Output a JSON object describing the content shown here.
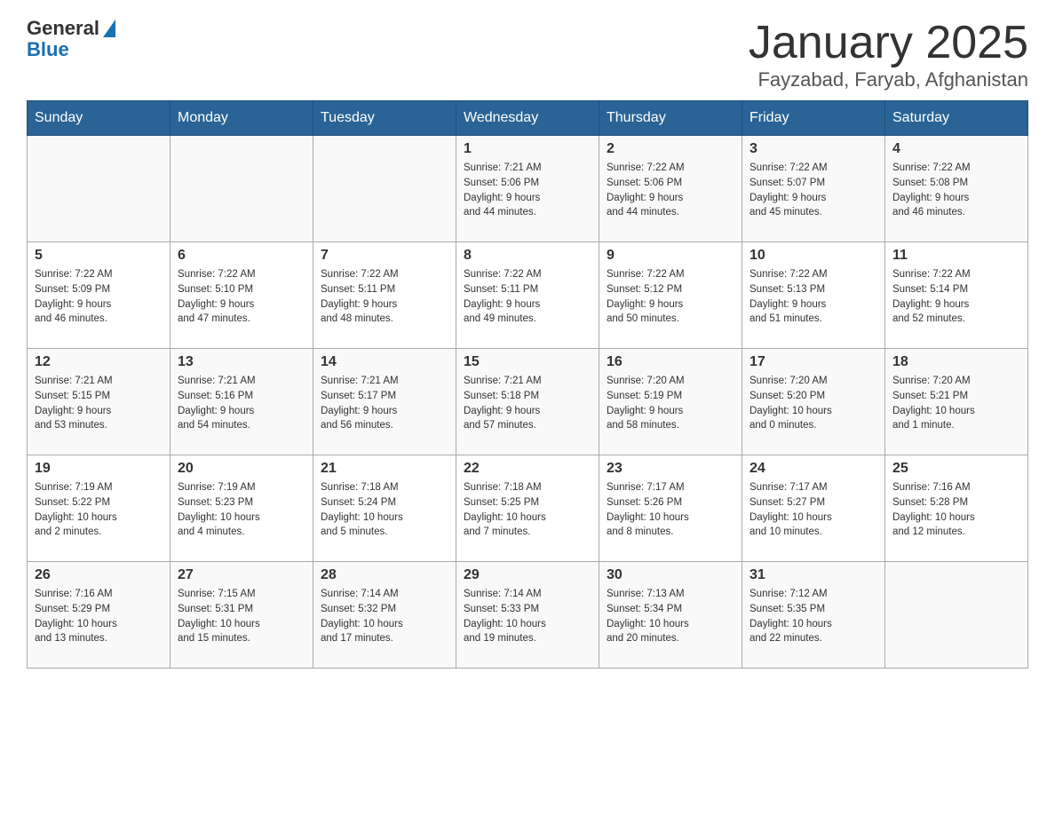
{
  "header": {
    "logo_line1": "General",
    "logo_line2": "Blue",
    "title": "January 2025",
    "subtitle": "Fayzabad, Faryab, Afghanistan"
  },
  "weekdays": [
    "Sunday",
    "Monday",
    "Tuesday",
    "Wednesday",
    "Thursday",
    "Friday",
    "Saturday"
  ],
  "weeks": [
    [
      {
        "day": "",
        "info": ""
      },
      {
        "day": "",
        "info": ""
      },
      {
        "day": "",
        "info": ""
      },
      {
        "day": "1",
        "info": "Sunrise: 7:21 AM\nSunset: 5:06 PM\nDaylight: 9 hours\nand 44 minutes."
      },
      {
        "day": "2",
        "info": "Sunrise: 7:22 AM\nSunset: 5:06 PM\nDaylight: 9 hours\nand 44 minutes."
      },
      {
        "day": "3",
        "info": "Sunrise: 7:22 AM\nSunset: 5:07 PM\nDaylight: 9 hours\nand 45 minutes."
      },
      {
        "day": "4",
        "info": "Sunrise: 7:22 AM\nSunset: 5:08 PM\nDaylight: 9 hours\nand 46 minutes."
      }
    ],
    [
      {
        "day": "5",
        "info": "Sunrise: 7:22 AM\nSunset: 5:09 PM\nDaylight: 9 hours\nand 46 minutes."
      },
      {
        "day": "6",
        "info": "Sunrise: 7:22 AM\nSunset: 5:10 PM\nDaylight: 9 hours\nand 47 minutes."
      },
      {
        "day": "7",
        "info": "Sunrise: 7:22 AM\nSunset: 5:11 PM\nDaylight: 9 hours\nand 48 minutes."
      },
      {
        "day": "8",
        "info": "Sunrise: 7:22 AM\nSunset: 5:11 PM\nDaylight: 9 hours\nand 49 minutes."
      },
      {
        "day": "9",
        "info": "Sunrise: 7:22 AM\nSunset: 5:12 PM\nDaylight: 9 hours\nand 50 minutes."
      },
      {
        "day": "10",
        "info": "Sunrise: 7:22 AM\nSunset: 5:13 PM\nDaylight: 9 hours\nand 51 minutes."
      },
      {
        "day": "11",
        "info": "Sunrise: 7:22 AM\nSunset: 5:14 PM\nDaylight: 9 hours\nand 52 minutes."
      }
    ],
    [
      {
        "day": "12",
        "info": "Sunrise: 7:21 AM\nSunset: 5:15 PM\nDaylight: 9 hours\nand 53 minutes."
      },
      {
        "day": "13",
        "info": "Sunrise: 7:21 AM\nSunset: 5:16 PM\nDaylight: 9 hours\nand 54 minutes."
      },
      {
        "day": "14",
        "info": "Sunrise: 7:21 AM\nSunset: 5:17 PM\nDaylight: 9 hours\nand 56 minutes."
      },
      {
        "day": "15",
        "info": "Sunrise: 7:21 AM\nSunset: 5:18 PM\nDaylight: 9 hours\nand 57 minutes."
      },
      {
        "day": "16",
        "info": "Sunrise: 7:20 AM\nSunset: 5:19 PM\nDaylight: 9 hours\nand 58 minutes."
      },
      {
        "day": "17",
        "info": "Sunrise: 7:20 AM\nSunset: 5:20 PM\nDaylight: 10 hours\nand 0 minutes."
      },
      {
        "day": "18",
        "info": "Sunrise: 7:20 AM\nSunset: 5:21 PM\nDaylight: 10 hours\nand 1 minute."
      }
    ],
    [
      {
        "day": "19",
        "info": "Sunrise: 7:19 AM\nSunset: 5:22 PM\nDaylight: 10 hours\nand 2 minutes."
      },
      {
        "day": "20",
        "info": "Sunrise: 7:19 AM\nSunset: 5:23 PM\nDaylight: 10 hours\nand 4 minutes."
      },
      {
        "day": "21",
        "info": "Sunrise: 7:18 AM\nSunset: 5:24 PM\nDaylight: 10 hours\nand 5 minutes."
      },
      {
        "day": "22",
        "info": "Sunrise: 7:18 AM\nSunset: 5:25 PM\nDaylight: 10 hours\nand 7 minutes."
      },
      {
        "day": "23",
        "info": "Sunrise: 7:17 AM\nSunset: 5:26 PM\nDaylight: 10 hours\nand 8 minutes."
      },
      {
        "day": "24",
        "info": "Sunrise: 7:17 AM\nSunset: 5:27 PM\nDaylight: 10 hours\nand 10 minutes."
      },
      {
        "day": "25",
        "info": "Sunrise: 7:16 AM\nSunset: 5:28 PM\nDaylight: 10 hours\nand 12 minutes."
      }
    ],
    [
      {
        "day": "26",
        "info": "Sunrise: 7:16 AM\nSunset: 5:29 PM\nDaylight: 10 hours\nand 13 minutes."
      },
      {
        "day": "27",
        "info": "Sunrise: 7:15 AM\nSunset: 5:31 PM\nDaylight: 10 hours\nand 15 minutes."
      },
      {
        "day": "28",
        "info": "Sunrise: 7:14 AM\nSunset: 5:32 PM\nDaylight: 10 hours\nand 17 minutes."
      },
      {
        "day": "29",
        "info": "Sunrise: 7:14 AM\nSunset: 5:33 PM\nDaylight: 10 hours\nand 19 minutes."
      },
      {
        "day": "30",
        "info": "Sunrise: 7:13 AM\nSunset: 5:34 PM\nDaylight: 10 hours\nand 20 minutes."
      },
      {
        "day": "31",
        "info": "Sunrise: 7:12 AM\nSunset: 5:35 PM\nDaylight: 10 hours\nand 22 minutes."
      },
      {
        "day": "",
        "info": ""
      }
    ]
  ]
}
